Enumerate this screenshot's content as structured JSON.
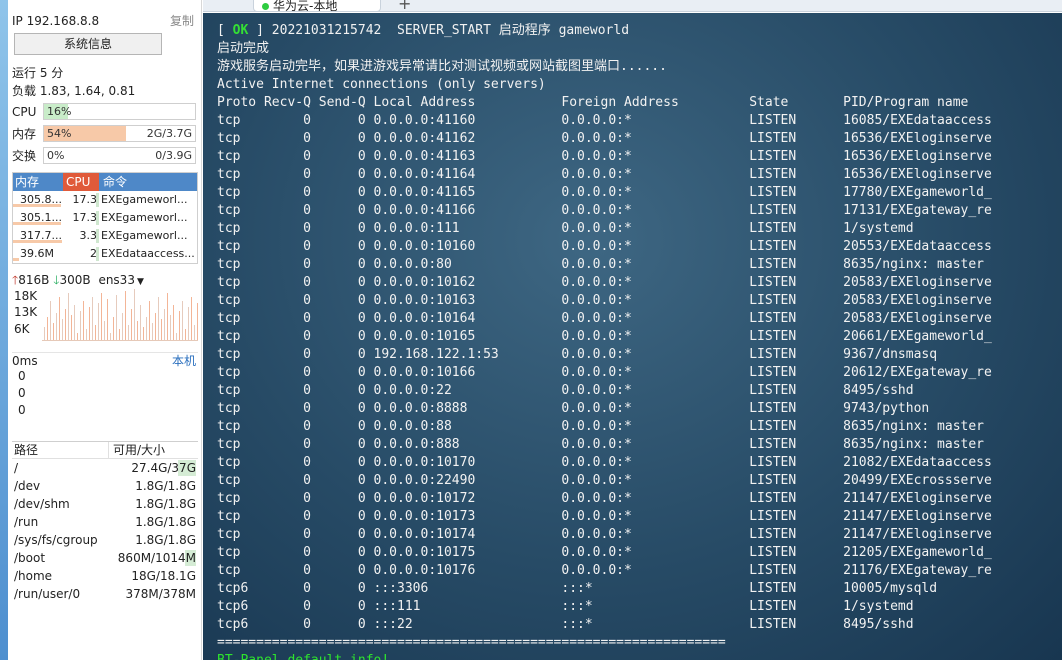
{
  "sidebar": {
    "ip": "IP 192.168.8.8",
    "copy_label": "复制",
    "sysinfo_label": "系统信息",
    "uptime": "运行 5 分",
    "load": "负载 1.83, 1.64, 0.81",
    "cpu": {
      "label": "CPU",
      "percent_text": "16%",
      "fraction": 0.16,
      "color": "#c9ecc9"
    },
    "mem": {
      "label": "内存",
      "percent_text": "54%",
      "value": "2G/3.7G",
      "fraction": 0.54,
      "color": "#f7c9a8"
    },
    "swap": {
      "label": "交换",
      "percent_text": "0%",
      "value": "0/3.9G",
      "fraction": 0.0,
      "color": "#e8e8e8"
    },
    "proc_headers": {
      "mem": "内存",
      "cpu": "CPU",
      "cmd": "命令"
    },
    "processes": [
      {
        "mem": "305.8...",
        "cpu": "17.3",
        "cmd": "EXEgameworl...",
        "mem_fraction": 0.95
      },
      {
        "mem": "305.1...",
        "cpu": "17.3",
        "cmd": "EXEgameworl...",
        "mem_fraction": 0.95
      },
      {
        "mem": "317.7...",
        "cpu": "3.3",
        "cmd": "EXEgameworl...",
        "mem_fraction": 0.98
      },
      {
        "mem": "39.6M",
        "cpu": "2",
        "cmd": "EXEdataaccess...",
        "mem_fraction": 0.12
      }
    ],
    "net": {
      "up": "816B",
      "down": "300B",
      "iface": "ens33",
      "scale": [
        "18K",
        "13K",
        "6K"
      ]
    },
    "ping": {
      "ms": "0ms",
      "link": "本机",
      "values": [
        "0",
        "0",
        "0"
      ]
    },
    "disk_headers": {
      "path": "路径",
      "size": "可用/大小"
    },
    "disks": [
      {
        "path": "/",
        "size": "27.4G/37G",
        "fraction": 0.26
      },
      {
        "path": "/dev",
        "size": "1.8G/1.8G",
        "fraction": 0.0
      },
      {
        "path": "/dev/shm",
        "size": "1.8G/1.8G",
        "fraction": 0.0
      },
      {
        "path": "/run",
        "size": "1.8G/1.8G",
        "fraction": 0.0
      },
      {
        "path": "/sys/fs/cgroup",
        "size": "1.8G/1.8G",
        "fraction": 0.0
      },
      {
        "path": "/boot",
        "size": "860M/1014M",
        "fraction": 0.15
      },
      {
        "path": "/home",
        "size": "18G/18.1G",
        "fraction": 0.0
      },
      {
        "path": "/run/user/0",
        "size": "378M/378M",
        "fraction": 0.0
      }
    ]
  },
  "tab": {
    "title": "华为云-本地"
  },
  "terminal": {
    "ok_text": "OK",
    "start_line_tail": " ] 20221031215742  SERVER_START 启动程序 gameworld",
    "lines": [
      "启动完成",
      "游戏服务启动完毕，如果进游戏异常请比对测试视频或网站截图里端口......",
      "Active Internet connections (only servers)",
      "Proto Recv-Q Send-Q Local Address           Foreign Address         State       PID/Program name",
      "tcp        0      0 0.0.0.0:41160           0.0.0.0:*               LISTEN      16085/EXEdataaccess",
      "tcp        0      0 0.0.0.0:41162           0.0.0.0:*               LISTEN      16536/EXEloginserve",
      "tcp        0      0 0.0.0.0:41163           0.0.0.0:*               LISTEN      16536/EXEloginserve",
      "tcp        0      0 0.0.0.0:41164           0.0.0.0:*               LISTEN      16536/EXEloginserve",
      "tcp        0      0 0.0.0.0:41165           0.0.0.0:*               LISTEN      17780/EXEgameworld_",
      "tcp        0      0 0.0.0.0:41166           0.0.0.0:*               LISTEN      17131/EXEgateway_re",
      "tcp        0      0 0.0.0.0:111             0.0.0.0:*               LISTEN      1/systemd",
      "tcp        0      0 0.0.0.0:10160           0.0.0.0:*               LISTEN      20553/EXEdataaccess",
      "tcp        0      0 0.0.0.0:80              0.0.0.0:*               LISTEN      8635/nginx: master",
      "tcp        0      0 0.0.0.0:10162           0.0.0.0:*               LISTEN      20583/EXEloginserve",
      "tcp        0      0 0.0.0.0:10163           0.0.0.0:*               LISTEN      20583/EXEloginserve",
      "tcp        0      0 0.0.0.0:10164           0.0.0.0:*               LISTEN      20583/EXEloginserve",
      "tcp        0      0 0.0.0.0:10165           0.0.0.0:*               LISTEN      20661/EXEgameworld_",
      "tcp        0      0 192.168.122.1:53        0.0.0.0:*               LISTEN      9367/dnsmasq",
      "tcp        0      0 0.0.0.0:10166           0.0.0.0:*               LISTEN      20612/EXEgateway_re",
      "tcp        0      0 0.0.0.0:22              0.0.0.0:*               LISTEN      8495/sshd",
      "tcp        0      0 0.0.0.0:8888            0.0.0.0:*               LISTEN      9743/python",
      "tcp        0      0 0.0.0.0:88              0.0.0.0:*               LISTEN      8635/nginx: master",
      "tcp        0      0 0.0.0.0:888             0.0.0.0:*               LISTEN      8635/nginx: master",
      "tcp        0      0 0.0.0.0:10170           0.0.0.0:*               LISTEN      21082/EXEdataaccess",
      "tcp        0      0 0.0.0.0:22490           0.0.0.0:*               LISTEN      20499/EXEcrossserve",
      "tcp        0      0 0.0.0.0:10172           0.0.0.0:*               LISTEN      21147/EXEloginserve",
      "tcp        0      0 0.0.0.0:10173           0.0.0.0:*               LISTEN      21147/EXEloginserve",
      "tcp        0      0 0.0.0.0:10174           0.0.0.0:*               LISTEN      21147/EXEloginserve",
      "tcp        0      0 0.0.0.0:10175           0.0.0.0:*               LISTEN      21205/EXEgameworld_",
      "tcp        0      0 0.0.0.0:10176           0.0.0.0:*               LISTEN      21176/EXEgateway_re",
      "tcp6       0      0 :::3306                 :::*                    LISTEN      10005/mysqld",
      "tcp6       0      0 :::111                  :::*                    LISTEN      1/systemd",
      "tcp6       0      0 :::22                   :::*                    LISTEN      8495/sshd",
      "=================================================================",
      "BT-Panel default info!"
    ]
  }
}
